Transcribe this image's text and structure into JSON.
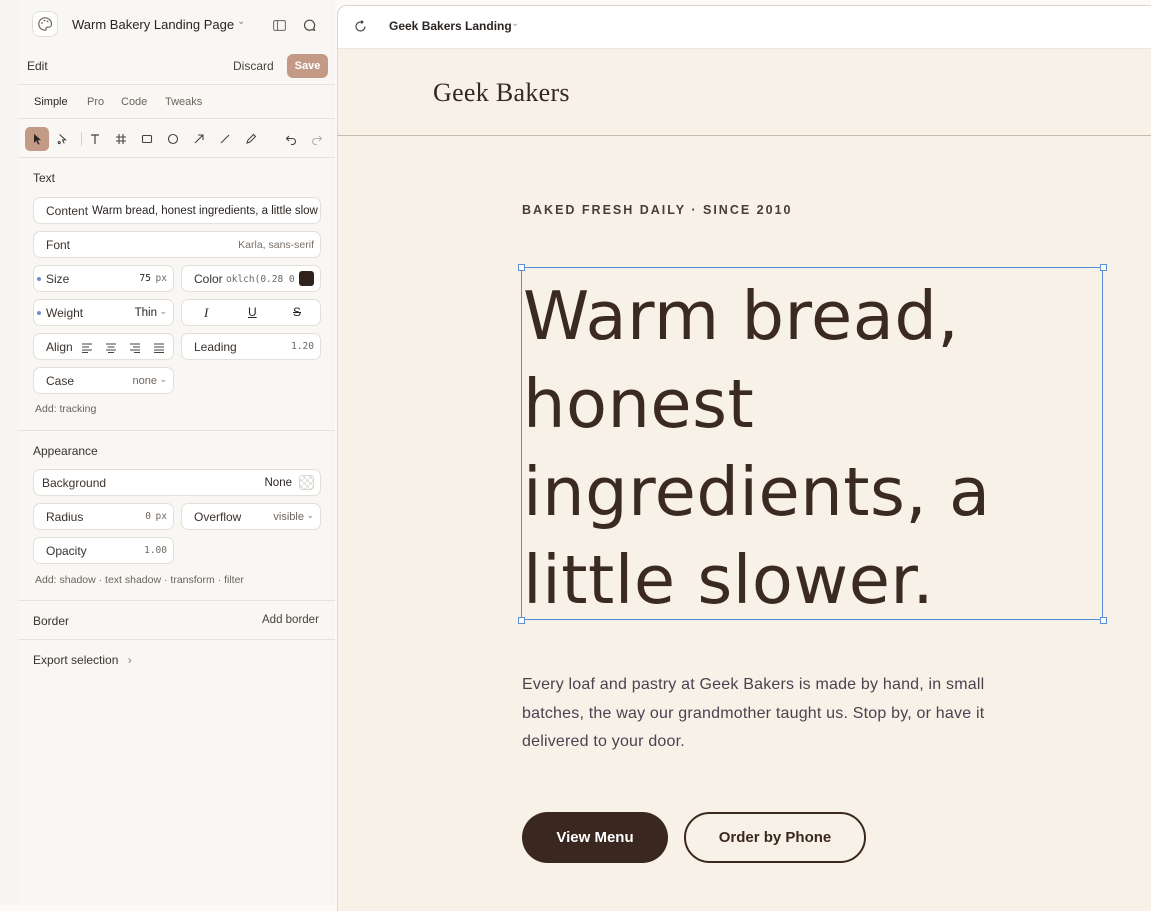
{
  "colors": {
    "accent": "#c39a86",
    "selection": "#5a8fd8",
    "site_bg": "#f8f1e8",
    "ink": "#3a2820",
    "swatch": "#2f221c"
  },
  "header": {
    "project_title": "Warm Bakery Landing Page"
  },
  "edit_bar": {
    "label": "Edit",
    "discard": "Discard",
    "save": "Save"
  },
  "tabs": [
    "Simple",
    "Pro",
    "Code",
    "Tweaks"
  ],
  "text_section": {
    "title": "Text",
    "content_label": "Content",
    "content_value": "Warm bread, honest ingredients, a little slow",
    "font_label": "Font",
    "font_value": "Karla, sans-serif",
    "size_label": "Size",
    "size_value": "75",
    "size_unit": "px",
    "color_label": "Color",
    "color_value": "oklch(0.28 0",
    "weight_label": "Weight",
    "weight_value": "Thin",
    "italic": "I",
    "underline": "U",
    "strike": "S",
    "align_label": "Align",
    "leading_label": "Leading",
    "leading_value": "1.20",
    "case_label": "Case",
    "case_value": "none",
    "add_link": "Add: tracking"
  },
  "appearance_section": {
    "title": "Appearance",
    "background_label": "Background",
    "background_value": "None",
    "radius_label": "Radius",
    "radius_value": "0",
    "radius_unit": "px",
    "overflow_label": "Overflow",
    "overflow_value": "visible",
    "opacity_label": "Opacity",
    "opacity_value": "1.00",
    "add_link": "Add: shadow · text shadow · transform · filter"
  },
  "border_section": {
    "title": "Border",
    "action": "Add border"
  },
  "export": {
    "label": "Export selection"
  },
  "preview": {
    "title": "Geek Bakers Landing",
    "brand": "Geek Bakers",
    "eyebrow": "BAKED FRESH DAILY · SINCE 2010",
    "headline_lines": [
      "Warm bread,",
      "honest",
      "ingredients, a",
      "little slower."
    ],
    "body": "Every loaf and pastry at Geek Bakers is made by hand, in small batches, the way our grandmother taught us. Stop by, or have it delivered to your door.",
    "primary_button": "View Menu",
    "secondary_button": "Order by Phone"
  }
}
